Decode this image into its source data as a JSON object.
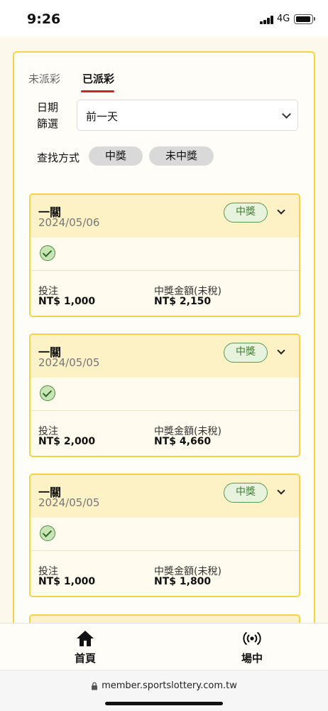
{
  "status_bar": {
    "time": "9:26",
    "network": "4G"
  },
  "tabs": [
    {
      "label": "未派彩",
      "active": false
    },
    {
      "label": "已派彩",
      "active": true
    }
  ],
  "filter": {
    "date_label": "日期篩選",
    "date_value": "前一天",
    "search_label": "查找方式",
    "search_options": [
      "中獎",
      "未中獎"
    ]
  },
  "cards": [
    {
      "title": "一關",
      "date": "2024/05/06",
      "badge": "中獎",
      "stake_label": "投注",
      "stake_value": "NT$ 1,000",
      "payout_label": "中獎金額(未稅)",
      "payout_value": "NT$ 2,150"
    },
    {
      "title": "一關",
      "date": "2024/05/05",
      "badge": "中獎",
      "stake_label": "投注",
      "stake_value": "NT$ 2,000",
      "payout_label": "中獎金額(未稅)",
      "payout_value": "NT$ 4,660"
    },
    {
      "title": "一關",
      "date": "2024/05/05",
      "badge": "中獎",
      "stake_label": "投注",
      "stake_value": "NT$ 1,000",
      "payout_label": "中獎金額(未稅)",
      "payout_value": "NT$ 1,800"
    }
  ],
  "bottom_nav": [
    {
      "label": "首頁",
      "icon": "home-icon"
    },
    {
      "label": "場中",
      "icon": "live-broadcast-icon"
    }
  ],
  "browser": {
    "url": "member.sportslottery.com.tw"
  },
  "colors": {
    "accent_red": "#c8242d",
    "card_border": "#f2d34a",
    "card_header": "#fdf1c6",
    "win_green": "#3f7d33"
  }
}
